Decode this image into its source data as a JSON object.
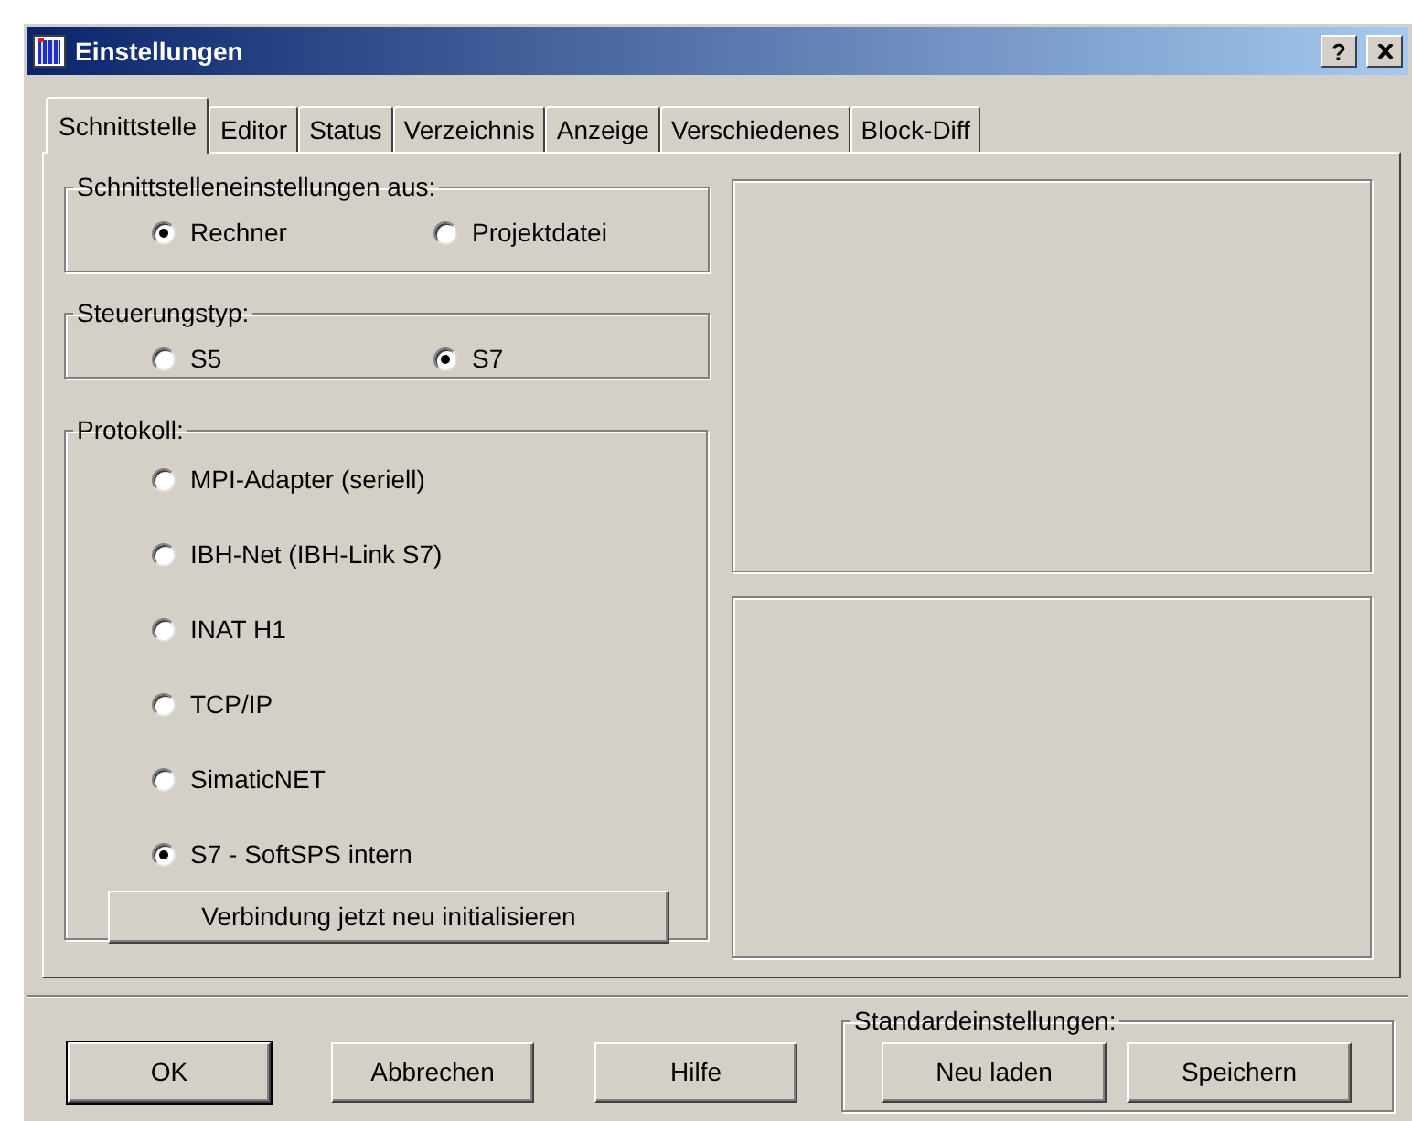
{
  "window": {
    "title": "Einstellungen",
    "help_button": "?"
  },
  "tabs": [
    {
      "label": "Schnittstelle",
      "selected": true
    },
    {
      "label": "Editor",
      "selected": false
    },
    {
      "label": "Status",
      "selected": false
    },
    {
      "label": "Verzeichnis",
      "selected": false
    },
    {
      "label": "Anzeige",
      "selected": false
    },
    {
      "label": "Verschiedenes",
      "selected": false
    },
    {
      "label": "Block-Diff",
      "selected": false
    }
  ],
  "interface_source": {
    "label": "Schnittstelleneinstellungen aus:",
    "options": [
      {
        "label": "Rechner",
        "selected": true
      },
      {
        "label": "Projektdatei",
        "selected": false
      }
    ]
  },
  "controller_type": {
    "label": "Steuerungstyp:",
    "options": [
      {
        "label": "S5",
        "selected": false
      },
      {
        "label": "S7",
        "selected": true
      }
    ]
  },
  "protocol": {
    "label": "Protokoll:",
    "options": [
      {
        "label": "MPI-Adapter (seriell)",
        "selected": false
      },
      {
        "label": "IBH-Net (IBH-Link S7)",
        "selected": false
      },
      {
        "label": "INAT H1",
        "selected": false
      },
      {
        "label": "TCP/IP",
        "selected": false
      },
      {
        "label": "SimaticNET",
        "selected": false
      },
      {
        "label": "S7 - SoftSPS intern",
        "selected": true
      }
    ],
    "button": "Verbindung jetzt neu initialisieren"
  },
  "footer_buttons": [
    {
      "label": "OK",
      "default": true
    },
    {
      "label": "Abbrechen",
      "default": false
    },
    {
      "label": "Hilfe",
      "default": false
    }
  ],
  "defaults": {
    "label": "Standardeinstellungen:",
    "buttons": [
      "Neu laden",
      "Speichern"
    ]
  }
}
